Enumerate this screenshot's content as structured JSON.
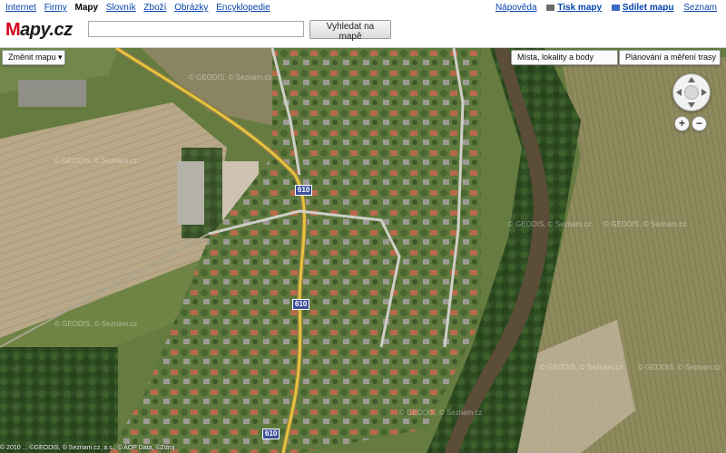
{
  "topnav": {
    "left": [
      "Internet",
      "Firmy",
      "Mapy",
      "Slovník",
      "Zboží",
      "Obrázky",
      "Encyklopedie"
    ],
    "active": "Mapy",
    "help": "Nápověda",
    "print": "Tisk mapy",
    "share": "Sdílet mapu",
    "seznam": "Seznam"
  },
  "header": {
    "logo_first": "M",
    "logo_rest": "apy.cz",
    "search_value": "",
    "search_button": "Vyhledat na mapě"
  },
  "map": {
    "change_map": "Změnit mapu",
    "places_button": "Místa, lokality a body",
    "route_button": "Plánování a měření trasy",
    "zoom_in": "+",
    "zoom_out": "−",
    "road_number": "610",
    "watermark": "© GEODIS, © Seznam.cz",
    "copyright": "© 2010 ... ©GEODIS, © Seznam.cz, a.s., © AOP Data, ©Zdroj"
  },
  "colors": {
    "link": "#0645ad",
    "road": "#e6c43c",
    "river": "#5b4d38",
    "road_label_bg": "#3d4f9a"
  }
}
